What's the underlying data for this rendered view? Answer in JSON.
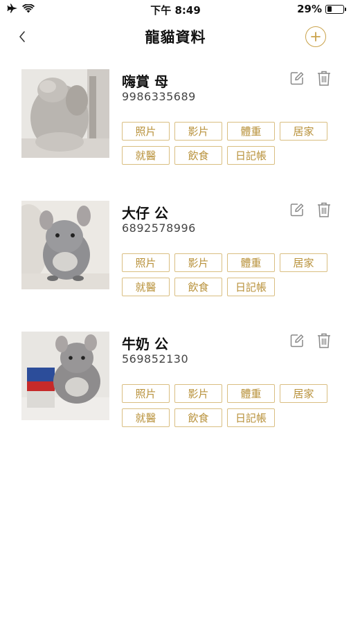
{
  "status_bar": {
    "time": "下午 8:49",
    "battery_text": "29%",
    "battery_level": 0.29
  },
  "header": {
    "title": "龍貓資料",
    "back_icon": "chevron-left-icon",
    "add_icon": "plus-circle-icon"
  },
  "colors": {
    "accent": "#c9a24a",
    "tag_border": "#d9be80",
    "tag_text": "#b8913a"
  },
  "pets": [
    {
      "name": "嗨賞 母",
      "id": "9986335689",
      "tags": [
        "照片",
        "影片",
        "體重",
        "居家",
        "就醫",
        "飲食",
        "日記帳"
      ]
    },
    {
      "name": "大仔 公",
      "id": "6892578996",
      "tags": [
        "照片",
        "影片",
        "體重",
        "居家",
        "就醫",
        "飲食",
        "日記帳"
      ]
    },
    {
      "name": "牛奶 公",
      "id": "569852130",
      "tags": [
        "照片",
        "影片",
        "體重",
        "居家",
        "就醫",
        "飲食",
        "日記帳"
      ]
    }
  ]
}
